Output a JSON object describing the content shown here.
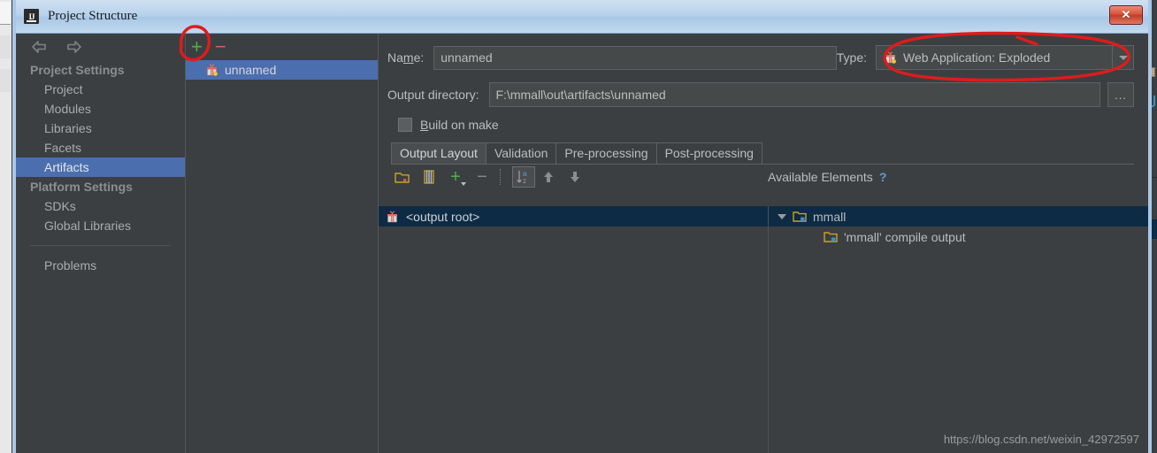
{
  "window": {
    "title": "Project Structure",
    "app_icon": "intellij-idea-icon",
    "close_label": "✕"
  },
  "sidebar": {
    "nav_back": "back-arrow",
    "nav_forward": "forward-arrow",
    "groups": [
      {
        "label": "Project Settings",
        "items": [
          {
            "label": "Project",
            "selected": false
          },
          {
            "label": "Modules",
            "selected": false
          },
          {
            "label": "Libraries",
            "selected": false
          },
          {
            "label": "Facets",
            "selected": false
          },
          {
            "label": "Artifacts",
            "selected": true
          }
        ]
      },
      {
        "label": "Platform Settings",
        "items": [
          {
            "label": "SDKs",
            "selected": false
          },
          {
            "label": "Global Libraries",
            "selected": false
          }
        ]
      }
    ],
    "problems_label": "Problems"
  },
  "artifacts_panel": {
    "add_label": "+",
    "remove_label": "−",
    "items": [
      {
        "label": "unnamed",
        "icon": "artifact-gift-icon",
        "selected": true
      }
    ]
  },
  "detail": {
    "name_label_pre": "Na",
    "name_label_mnemonic": "m",
    "name_label_post": "e:",
    "name_value": "unnamed",
    "type_label": "Type:",
    "type_value": "Web Application: Exploded",
    "type_icon": "artifact-gift-icon",
    "outdir_label": "Output directory:",
    "outdir_value": "F:\\mmall\\out\\artifacts\\unnamed",
    "browse_label": "...",
    "buildmake_pre": "",
    "buildmake_mnemonic": "B",
    "buildmake_post": "uild on make",
    "buildmake_checked": false,
    "tabs": [
      {
        "label": "Output Layout",
        "active": true
      },
      {
        "label": "Validation",
        "active": false
      },
      {
        "label": "Pre-processing",
        "active": false
      },
      {
        "label": "Post-processing",
        "active": false
      }
    ],
    "toolbar": [
      {
        "name": "add-directory-icon",
        "label": ""
      },
      {
        "name": "add-archive-icon",
        "label": ""
      },
      {
        "name": "add-copy-icon",
        "label": ""
      },
      {
        "name": "remove-icon",
        "label": ""
      },
      {
        "name": "sort-az-icon",
        "label": ""
      },
      {
        "name": "move-up-icon",
        "label": ""
      },
      {
        "name": "move-down-icon",
        "label": ""
      }
    ],
    "available_elements_label": "Available Elements",
    "available_help": "?",
    "output_tree": [
      {
        "label": "<output root>",
        "icon": "artifact-gift-icon",
        "selected": true
      }
    ],
    "available_tree": [
      {
        "label": "mmall",
        "icon": "module-folder-icon",
        "selected": true,
        "expanded": true,
        "indent": 0
      },
      {
        "label": "'mmall' compile output",
        "icon": "module-folder-icon",
        "selected": false,
        "expanded": false,
        "indent": 1
      }
    ]
  },
  "watermark": "https://blog.csdn.net/weixin_42972597",
  "annotations": {
    "circle_add_button": "red-ellipse-around-add-button",
    "circle_type_combo": "red-ellipse-around-type-combo"
  },
  "colors": {
    "accent_selection": "#4b6eaf",
    "tree_selection": "#0d2b45",
    "panel_bg": "#3c3f41",
    "field_bg": "#45494a",
    "annotation_red": "#e01b1b",
    "add_green": "#4caf50",
    "remove_red": "#d06060"
  }
}
